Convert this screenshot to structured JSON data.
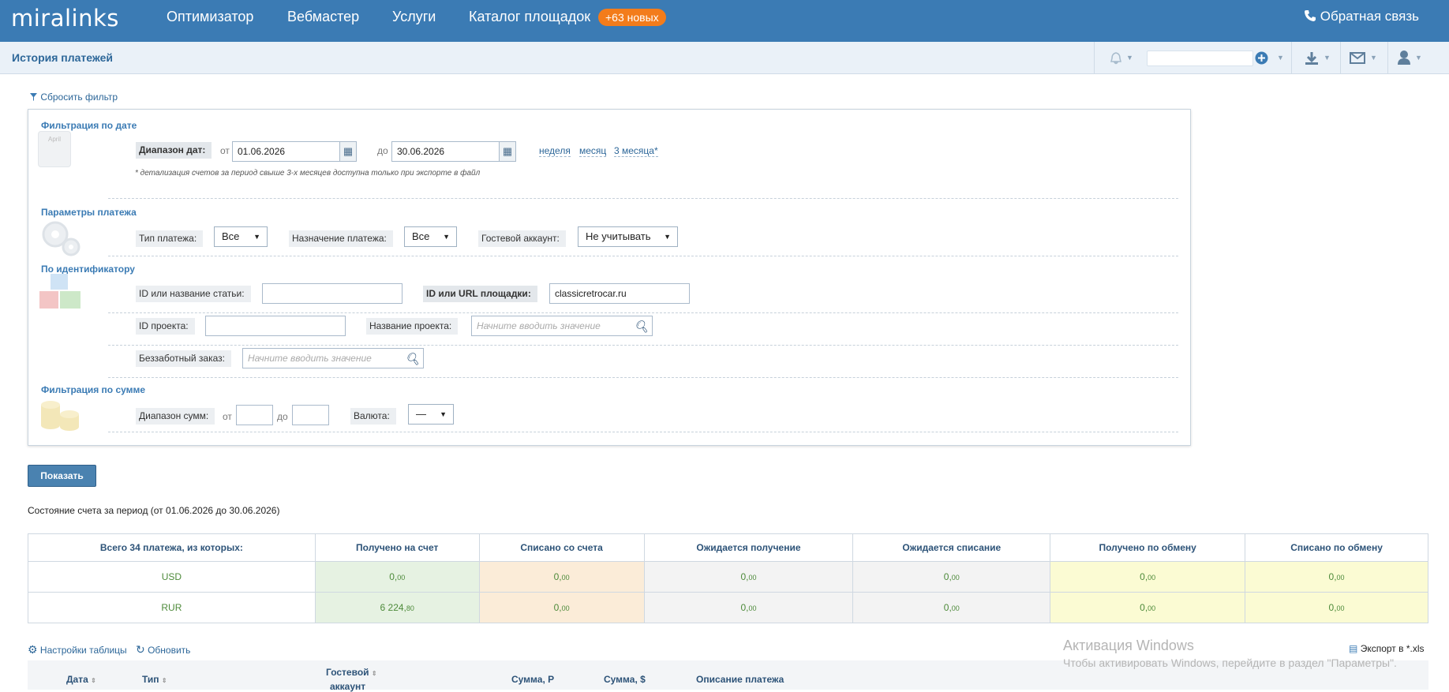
{
  "header": {
    "logo": "miralinks",
    "nav": [
      "Оптимизатор",
      "Вебмастер",
      "Услуги",
      "Каталог площадок"
    ],
    "badge": "+63 новых",
    "feedback": "Обратная связь",
    "feedback_icon": "phone-icon"
  },
  "subbar": {
    "title": "История платежей"
  },
  "reset_filter": "Сбросить фильтр",
  "date_filter": {
    "section": "Фильтрация по дате",
    "illustration": "April",
    "range_label": "Диапазон дат:",
    "from": "от",
    "from_value": "01.06.2026",
    "to": "до",
    "to_value": "30.06.2026",
    "presets": [
      "неделя",
      "месяц",
      "3 месяца*"
    ],
    "note": "* детализация счетов за период свыше 3-х месяцев доступна только при экспорте в файл"
  },
  "payment_params": {
    "section": "Параметры платежа",
    "type_label": "Тип платежа:",
    "type_value": "Все",
    "purpose_label": "Назначение платежа:",
    "purpose_value": "Все",
    "guest_label": "Гостевой аккаунт:",
    "guest_value": "Не учитывать"
  },
  "identifier": {
    "section": "По идентификатору",
    "article_label": "ID или название статьи:",
    "article_value": "",
    "site_label": "ID или URL площадки:",
    "site_value": "classicretrocar.ru",
    "project_id_label": "ID проекта:",
    "project_id_value": "",
    "project_name_label": "Название проекта:",
    "project_name_placeholder": "Начните вводить значение",
    "carefree_label": "Беззаботный заказ:",
    "carefree_placeholder": "Начните вводить значение"
  },
  "sum_filter": {
    "section": "Фильтрация по сумме",
    "range_label": "Диапазон сумм:",
    "from": "от",
    "to": "до",
    "currency_label": "Валюта:",
    "currency_value": "—"
  },
  "show_button": "Показать",
  "status_text": "Состояние счета за период (от 01.06.2026 до 30.06.2026)",
  "summary": {
    "headers": [
      "Всего 34 платежа, из которых:",
      "Получено на счет",
      "Списано со счета",
      "Ожидается получение",
      "Ожидается списание",
      "Получено по обмену",
      "Списано по обмену"
    ],
    "rows": [
      {
        "currency": "USD",
        "values": [
          [
            "0,",
            "00"
          ],
          [
            "0,",
            "00"
          ],
          [
            "0,",
            "00"
          ],
          [
            "0,",
            "00"
          ],
          [
            "0,",
            "00"
          ],
          [
            "0,",
            "00"
          ]
        ]
      },
      {
        "currency": "RUR",
        "values": [
          [
            "6 224,",
            "80"
          ],
          [
            "0,",
            "00"
          ],
          [
            "0,",
            "00"
          ],
          [
            "0,",
            "00"
          ],
          [
            "0,",
            "00"
          ],
          [
            "0,",
            "00"
          ]
        ]
      }
    ]
  },
  "footer": {
    "table_settings": "Настройки таблицы",
    "refresh": "Обновить",
    "export": "Экспорт в *.xls"
  },
  "watermark": {
    "title": "Активация Windows",
    "text": "Чтобы активировать Windows, перейдите в раздел \"Параметры\"."
  },
  "list_headers": {
    "date": "Дата",
    "type": "Тип",
    "guest_line1": "Гостевой",
    "guest_line2": "аккаунт",
    "sum_rub": "Сумма, Р",
    "sum_usd": "Сумма, $",
    "description": "Описание платежа"
  }
}
